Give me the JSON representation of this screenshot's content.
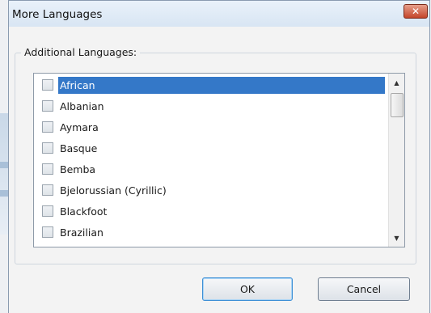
{
  "dialog": {
    "title": "More Languages",
    "close_glyph": "✕"
  },
  "group": {
    "label": "Additional Languages:"
  },
  "languages": [
    {
      "label": "African",
      "checked": false,
      "selected": true
    },
    {
      "label": "Albanian",
      "checked": false,
      "selected": false
    },
    {
      "label": "Aymara",
      "checked": false,
      "selected": false
    },
    {
      "label": "Basque",
      "checked": false,
      "selected": false
    },
    {
      "label": "Bemba",
      "checked": false,
      "selected": false
    },
    {
      "label": "Bjelorussian (Cyrillic)",
      "checked": false,
      "selected": false
    },
    {
      "label": "Blackfoot",
      "checked": false,
      "selected": false
    },
    {
      "label": "Brazilian",
      "checked": false,
      "selected": false
    }
  ],
  "scrollbar": {
    "up_glyph": "▲",
    "down_glyph": "▼"
  },
  "buttons": {
    "ok_label": "OK",
    "cancel_label": "Cancel"
  }
}
